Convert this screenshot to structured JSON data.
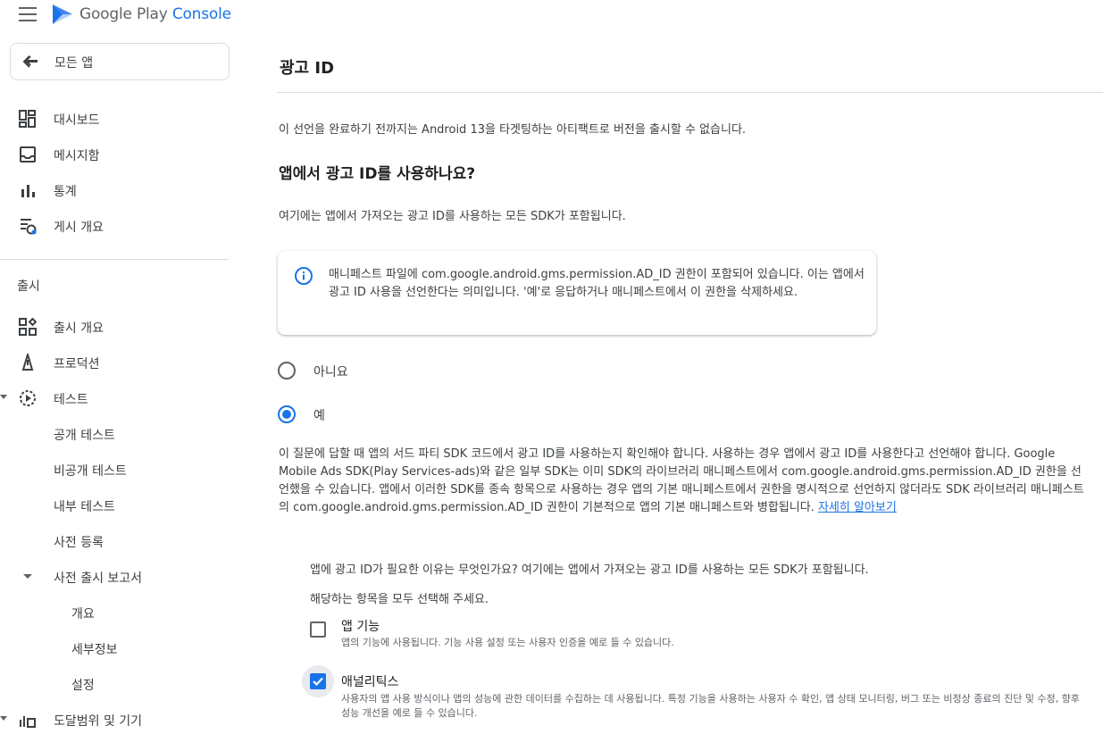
{
  "app": {
    "brand_prefix": "Google Play ",
    "brand_accent": "Console",
    "brand_color": "#1a73e8"
  },
  "sidebar": {
    "all_apps_label": "모든 앱",
    "top_items": [
      {
        "label": "대시보드",
        "icon": "dashboard-icon"
      },
      {
        "label": "메시지함",
        "icon": "inbox-icon"
      },
      {
        "label": "통계",
        "icon": "bar-chart-icon"
      },
      {
        "label": "게시 개요",
        "icon": "publishing-overview-icon"
      }
    ],
    "section_release": "출시",
    "release_items": [
      {
        "label": "출시 개요",
        "icon": "release-overview-icon"
      },
      {
        "label": "프로덕션",
        "icon": "production-icon"
      },
      {
        "label": "테스트",
        "icon": "testing-icon"
      }
    ],
    "test_sub_items": [
      "공개 테스트",
      "비공개 테스트",
      "내부 테스트",
      "사전 등록"
    ],
    "pre_launch_report": "사전 출시 보고서",
    "pre_launch_sub_items": [
      "개요",
      "세부정보",
      "설정"
    ],
    "reach_devices": "도달범위 및 기기"
  },
  "main": {
    "page_title": "광고 ID",
    "intro": "이 선언을 완료하기 전까지는 Android 13을 타겟팅하는 아티팩트로 버전을 출시할 수 없습니다.",
    "question": "앱에서 광고 ID를 사용하나요?",
    "question_sub": "여기에는 앱에서 가져오는 광고 ID를 사용하는 모든 SDK가 포함됩니다.",
    "info_box": "매니페스트 파일에 com.google.android.gms.permission.AD_ID 권한이 포함되어 있습니다. 이는 앱에서 광고 ID 사용을 선언한다는 의미입니다. '예'로 응답하거나 매니페스트에서 이 권한을 삭제하세요.",
    "radio_no": "아니요",
    "radio_yes": "예",
    "selected_radio": "예",
    "description": "이 질문에 답할 때 앱의 서드 파티 SDK 코드에서 광고 ID를 사용하는지 확인해야 합니다. 사용하는 경우 앱에서 광고 ID를 사용한다고 선언해야 합니다. Google Mobile Ads SDK(Play Services-ads)와 같은 일부 SDK는 이미 SDK의 라이브러리 매니페스트에서 com.google.android.gms.permission.AD_ID 권한을 선언했을 수 있습니다. 앱에서 이러한 SDK를 종속 항목으로 사용하는 경우 앱의 기본 매니페스트에서 권한을 명시적으로 선언하지 않더라도 SDK 라이브러리 매니페스트의 com.google.android.gms.permission.AD_ID 권한이 기본적으로 앱의 기본 매니페스트와 병합됩니다. ",
    "learn_more": "자세히 알아보기",
    "purpose_question": "앱에 광고 ID가 필요한 이유는 무엇인가요? 여기에는 앱에서 가져오는 광고 ID를 사용하는 모든 SDK가 포함됩니다.",
    "purpose_hint": "해당하는 항목을 모두 선택해 주세요.",
    "checkboxes": [
      {
        "label": "앱 기능",
        "help": "앱의 기능에 사용됩니다. 기능 사용 설정 또는 사용자 인증을 예로 들 수 있습니다.",
        "checked": false
      },
      {
        "label": "애널리틱스",
        "help": "사용자의 앱 사용 방식이나 앱의 성능에 관한 데이터를 수집하는 데 사용됩니다. 특정 기능을 사용하는 사용자 수 확인, 앱 상태 모니터링, 버그 또는 비정상 종료의 진단 및 수정, 향후 성능 개선을 예로 들 수 있습니다.",
        "checked": true
      }
    ]
  }
}
